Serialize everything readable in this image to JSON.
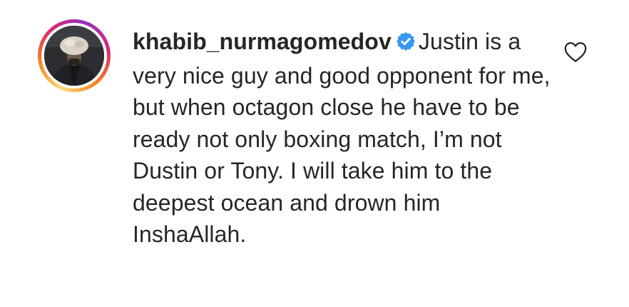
{
  "comment": {
    "username": "khabib_nurmagomedov",
    "verified": true,
    "text": "Justin is a very nice guy and good opponent for me, but when octagon close he have to be ready not only boxing match, I’m not Dustin or Tony. I will take him to the deepest ocean and drown him InshaAllah."
  },
  "icons": {
    "verified": "verified-badge-icon",
    "like": "heart-outline-icon"
  },
  "colors": {
    "verified_blue": "#3897f0",
    "text": "#262626",
    "story_ring": [
      "#feda75",
      "#fa7e1e",
      "#d62976",
      "#962fbf"
    ]
  }
}
